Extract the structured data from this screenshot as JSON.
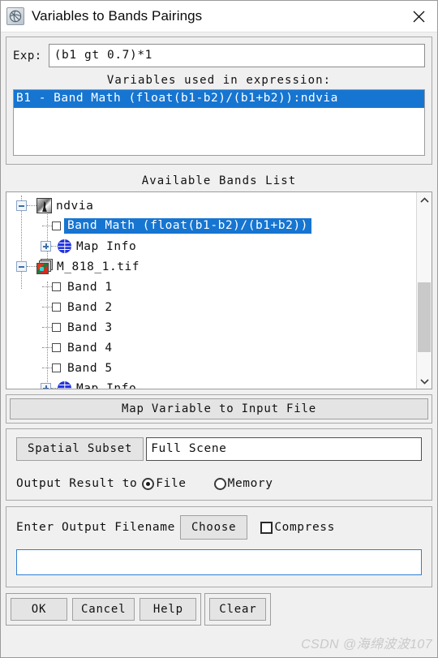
{
  "window": {
    "title": "Variables to Bands Pairings",
    "app_icon": "envi-globe-icon",
    "close_label": "×"
  },
  "expression": {
    "label": "Exp:",
    "value": "(b1 gt 0.7)*1"
  },
  "variables_section": {
    "caption": "Variables used in expression:",
    "items": [
      {
        "text": "B1 - Band Math (float(b1-b2)/(b1+b2)):ndvia",
        "selected": true
      }
    ]
  },
  "bands_section": {
    "caption": "Available Bands List",
    "tree": [
      {
        "label": "ndvia",
        "type": "raster-group",
        "expander": "minus",
        "icon": "raster-icon",
        "depth": 0,
        "selected": false
      },
      {
        "label": "Band Math (float(b1-b2)/(b1+b2))",
        "type": "band",
        "expander": "none",
        "icon": "checkbox-icon",
        "depth": 1,
        "selected": true
      },
      {
        "label": "Map Info",
        "type": "map-info",
        "expander": "plus",
        "icon": "globe-icon",
        "depth": 1,
        "selected": false
      },
      {
        "label": "M_818_1.tif",
        "type": "file-group",
        "expander": "minus",
        "icon": "file-stack-icon",
        "depth": 0,
        "selected": false
      },
      {
        "label": "Band 1",
        "type": "band",
        "expander": "none",
        "icon": "checkbox-icon",
        "depth": 1,
        "selected": false
      },
      {
        "label": "Band 2",
        "type": "band",
        "expander": "none",
        "icon": "checkbox-icon",
        "depth": 1,
        "selected": false
      },
      {
        "label": "Band 3",
        "type": "band",
        "expander": "none",
        "icon": "checkbox-icon",
        "depth": 1,
        "selected": false
      },
      {
        "label": "Band 4",
        "type": "band",
        "expander": "none",
        "icon": "checkbox-icon",
        "depth": 1,
        "selected": false
      },
      {
        "label": "Band 5",
        "type": "band",
        "expander": "none",
        "icon": "checkbox-icon",
        "depth": 1,
        "selected": false
      },
      {
        "label": "Map Info",
        "type": "map-info",
        "expander": "plus",
        "icon": "globe-icon",
        "depth": 1,
        "selected": false
      }
    ],
    "scrollbar": {
      "up_icon": "chevron-up-icon",
      "down_icon": "chevron-down-icon"
    }
  },
  "map_variable_button": {
    "label": "Map Variable to Input File"
  },
  "output_options": {
    "spatial_subset_button": "Spatial Subset",
    "spatial_subset_value": "Full Scene",
    "output_result_label": "Output Result to",
    "radios": [
      {
        "label": "File",
        "selected": true
      },
      {
        "label": "Memory",
        "selected": false
      }
    ]
  },
  "filename_section": {
    "label": "Enter Output Filename",
    "choose_button": "Choose",
    "compress_label": "Compress",
    "compress_checked": false,
    "filename_value": "",
    "filename_placeholder": ""
  },
  "footer": {
    "primary": [
      {
        "label": "OK"
      },
      {
        "label": "Cancel"
      },
      {
        "label": "Help"
      }
    ],
    "secondary": [
      {
        "label": "Clear"
      }
    ]
  },
  "watermark": {
    "text": "CSDN @海绵波波107"
  },
  "colors": {
    "selection_blue": "#1675d1",
    "dialog_bg": "#f0f0f0",
    "field_bg": "#ffffff",
    "focus_border": "#2f7fd1"
  }
}
